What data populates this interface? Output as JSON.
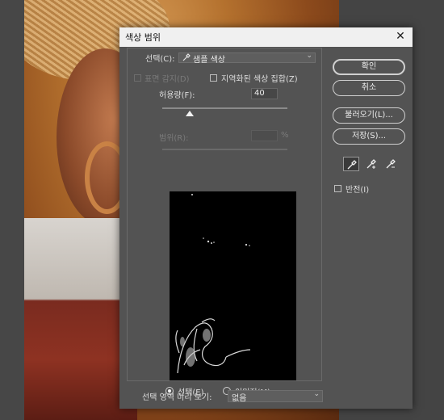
{
  "dialog": {
    "title": "색상 범위",
    "close_symbol": "✕",
    "select_label": "선택(C):",
    "select_value": "샘플 색상",
    "detect_faces_label": "표면 감지(D)",
    "localized_clusters_label": "지역화된 색상 집합(Z)",
    "fuzziness_label": "허용량(F):",
    "fuzziness_value": "40",
    "fuzziness_level": 0.22,
    "range_label": "범위(R):",
    "range_unit": "%",
    "view_selection_label": "선택(E)",
    "view_image_label": "이미지(M)",
    "view_mode": "selection",
    "preview_label": "선택 영역 미리 보기:",
    "preview_value": "없음",
    "invert_label": "반전(I)"
  },
  "buttons": {
    "ok": "확인",
    "cancel": "취소",
    "load": "불러오기(L)...",
    "save": "저장(S)..."
  },
  "tools": [
    "eyedropper-icon",
    "eyedropper-plus-icon",
    "eyedropper-minus-icon"
  ]
}
